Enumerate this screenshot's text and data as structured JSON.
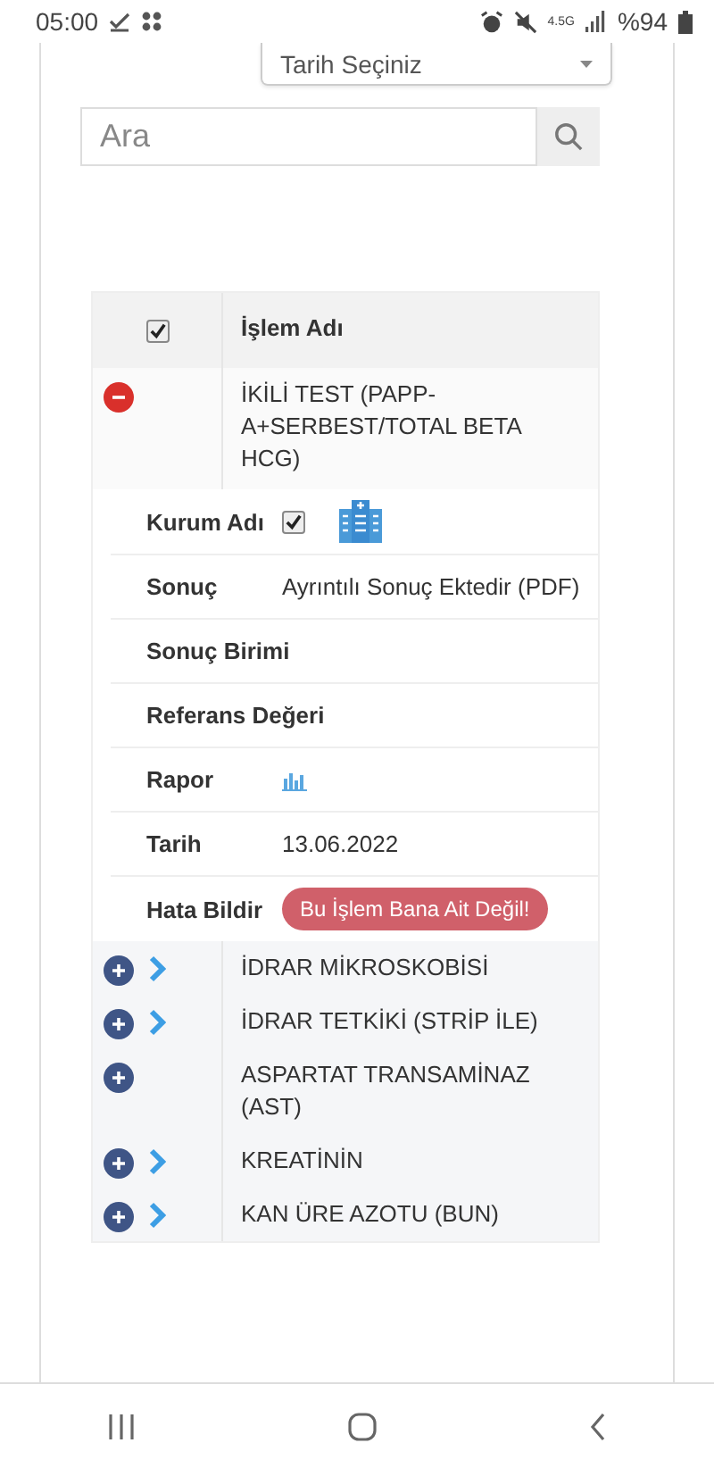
{
  "status_bar": {
    "time": "05:00",
    "network": "4.5G",
    "battery": "%94"
  },
  "date_select": {
    "value": "Tarih Seçiniz"
  },
  "search": {
    "placeholder": "Ara"
  },
  "table": {
    "header": {
      "checked": true,
      "title": "İşlem Adı"
    },
    "rows": [
      {
        "name": "İKİLİ TEST (PAPP-A+SERBEST/TOTAL BETA HCG)",
        "expanded": true,
        "chevron": false,
        "details": [
          {
            "kind": "institution",
            "label": "Kurum Adı",
            "checked": true
          },
          {
            "kind": "text",
            "label": "Sonuç",
            "value": "Ayrıntılı Sonuç Ektedir (PDF)"
          },
          {
            "kind": "text",
            "label": "Sonuç Birimi"
          },
          {
            "kind": "text",
            "label": "Referans Değeri"
          },
          {
            "kind": "report",
            "label": "Rapor"
          },
          {
            "kind": "text",
            "label": "Tarih",
            "value": "13.06.2022"
          },
          {
            "kind": "button",
            "label": "Hata Bildir",
            "value": "Bu İşlem Bana Ait Değil!"
          }
        ]
      },
      {
        "name": "İDRAR MİKROSKOBİSİ",
        "expanded": false,
        "chevron": true
      },
      {
        "name": "İDRAR TETKİKİ (STRİP İLE)",
        "expanded": false,
        "chevron": true
      },
      {
        "name": "ASPARTAT TRANSAMİNAZ (AST)",
        "expanded": false,
        "chevron": false
      },
      {
        "name": "KREATİNİN",
        "expanded": false,
        "chevron": true
      },
      {
        "name": "KAN ÜRE AZOTU (BUN)",
        "expanded": false,
        "chevron": true
      }
    ]
  }
}
